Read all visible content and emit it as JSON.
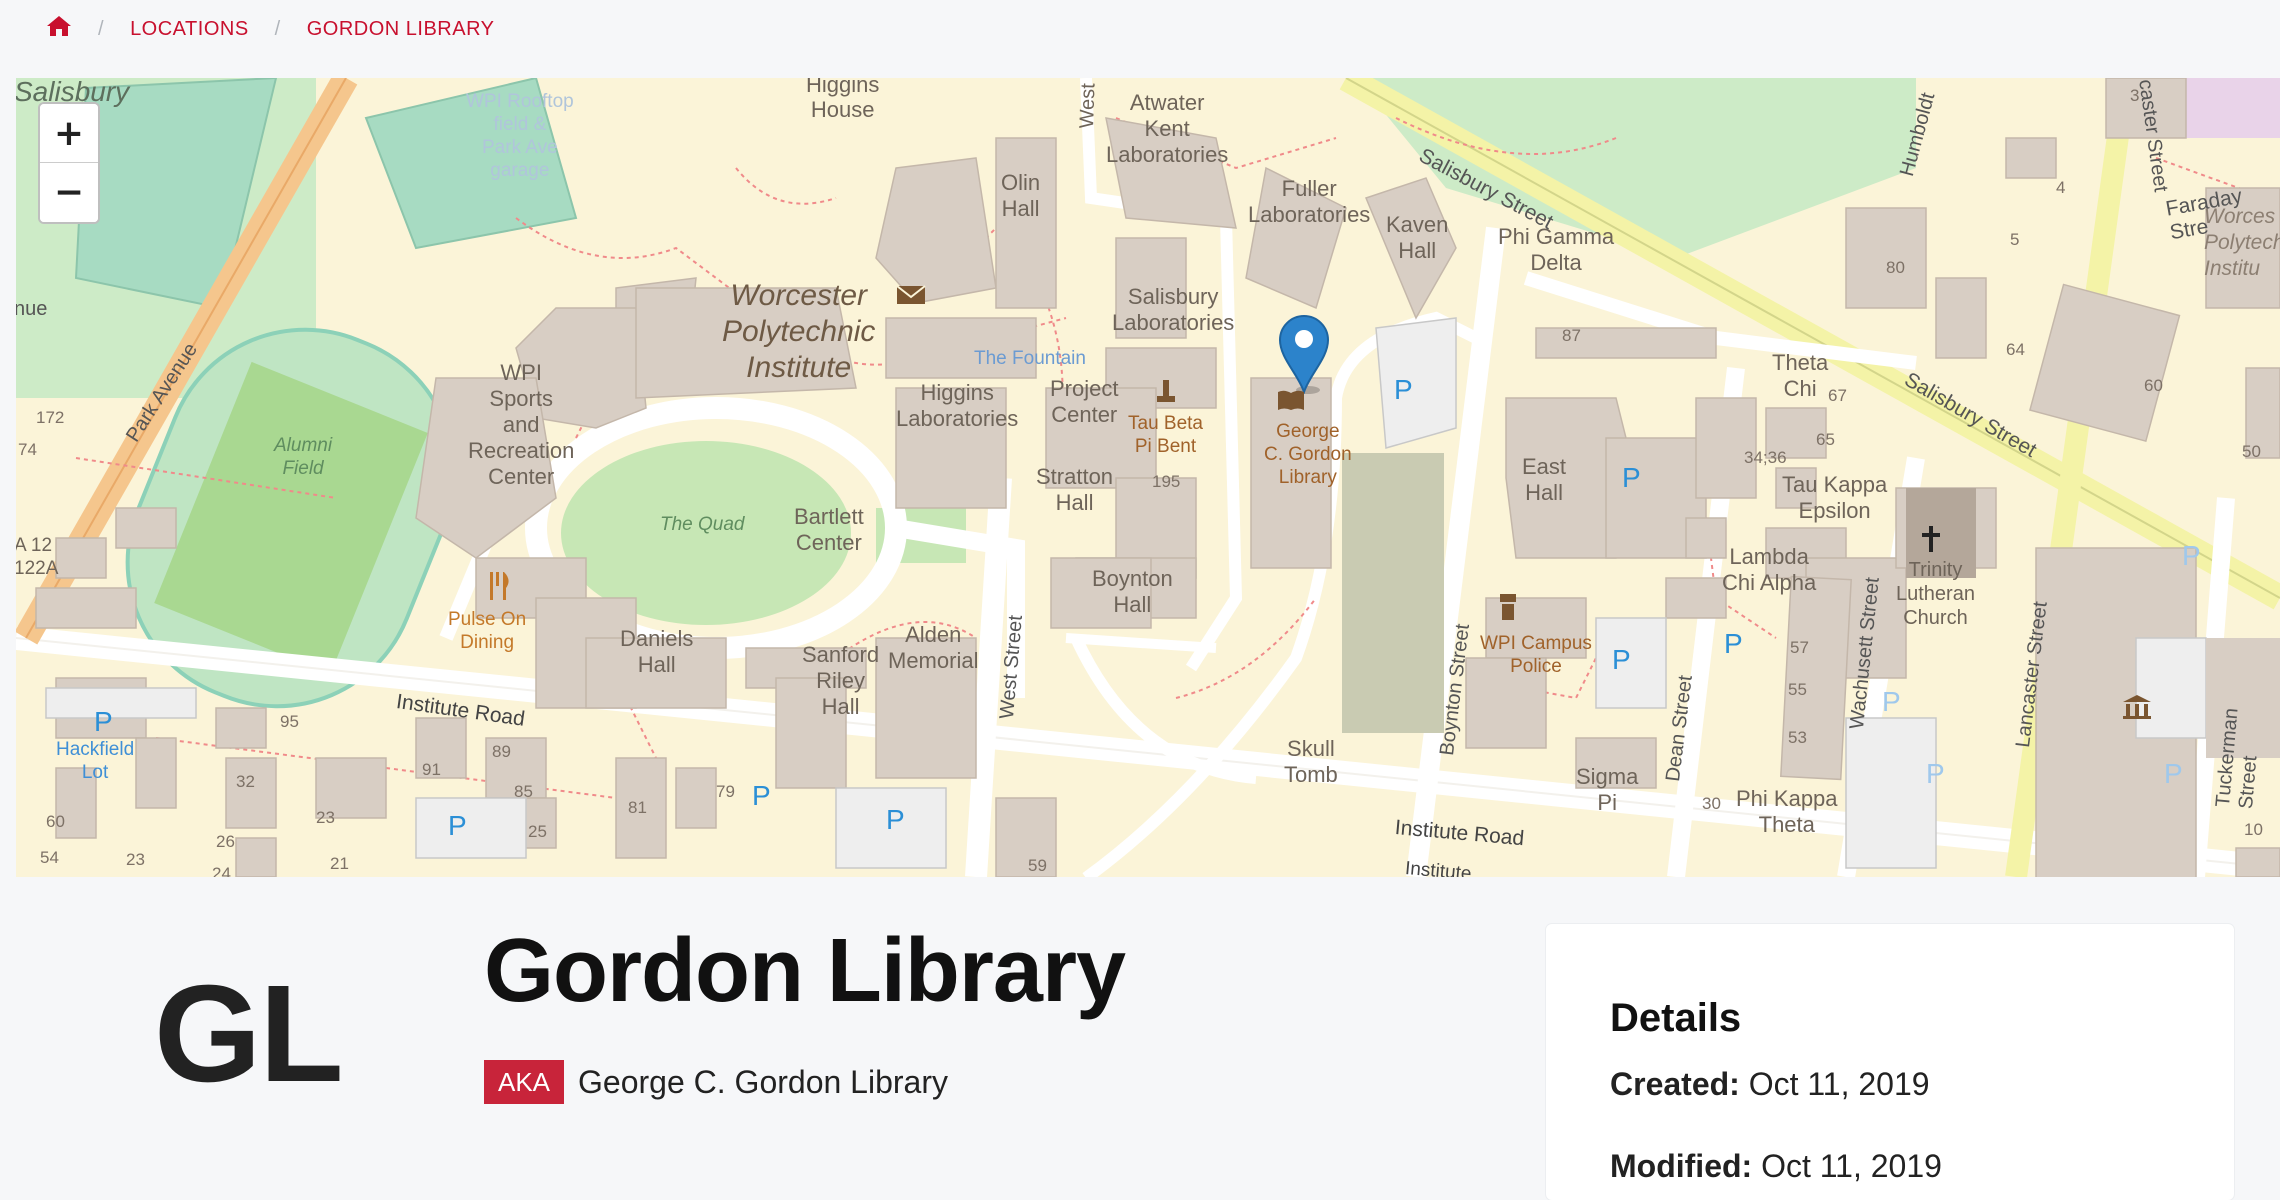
{
  "breadcrumb": {
    "home_icon": "home-icon",
    "items": [
      "LOCATIONS",
      "GORDON LIBRARY"
    ]
  },
  "map": {
    "zoom_in": "+",
    "zoom_out": "−",
    "marker_icon": "map-pin-icon",
    "labels": {
      "salisbury_corner": "Salisbury",
      "rooftop": [
        "WPI Rooftop",
        "field &",
        "Park Ave",
        "garage"
      ],
      "higgins_house": [
        "Higgins",
        "House"
      ],
      "west_top": "West",
      "atwater": [
        "Atwater",
        "Kent",
        "Laboratories"
      ],
      "olin": [
        "Olin",
        "Hall"
      ],
      "fuller": [
        "Fuller",
        "Laboratories"
      ],
      "kaven": [
        "Kaven",
        "Hall"
      ],
      "phi_gamma": [
        "Phi Gamma",
        "Delta"
      ],
      "salisbury_street": "Salisbury Street",
      "salisbury_street_2": "Salisbury Street",
      "humboldt": "Humboldt",
      "lancaster_top": "caster Street",
      "faraday": "Faraday Stre",
      "wpi_corner": [
        "Worces",
        "Polytech",
        "Institu"
      ],
      "worcester_poly": [
        "Worcester",
        "Polytechnic",
        "Institute"
      ],
      "salisbury_labs": [
        "Salisbury",
        "Laboratories"
      ],
      "the_fountain": "The Fountain",
      "park_avenue": "Park Avenue",
      "nue": "nue",
      "wpi_sports": [
        "WPI",
        "Sports",
        "and",
        "Recreation",
        "Center"
      ],
      "alumni_field": [
        "Alumni",
        "Field"
      ],
      "higgins_labs": [
        "Higgins",
        "Laboratories"
      ],
      "project_center": [
        "Project",
        "Center"
      ],
      "tau_beta": [
        "Tau Beta",
        "Pi Bent"
      ],
      "gordon_library": [
        "George",
        "C. Gordon",
        "Library"
      ],
      "theta_chi": [
        "Theta",
        "Chi"
      ],
      "east_hall": [
        "East",
        "Hall"
      ],
      "tau_kappa": [
        "Tau Kappa",
        "Epsilon"
      ],
      "lambda_chi": [
        "Lambda",
        "Chi Alpha"
      ],
      "trinity": [
        "Trinity",
        "Lutheran",
        "Church"
      ],
      "the_quad": "The Quad",
      "bartlett": [
        "Bartlett",
        "Center"
      ],
      "stratton": [
        "Stratton",
        "Hall"
      ],
      "boynton_hall": [
        "Boynton",
        "Hall"
      ],
      "pulse_on": [
        "Pulse On",
        "Dining"
      ],
      "daniels": [
        "Daniels",
        "Hall"
      ],
      "sanford": [
        "Sanford",
        "Riley",
        "Hall"
      ],
      "alden": [
        "Alden",
        "Memorial"
      ],
      "west_street": "West Street",
      "boynton_street": "Boynton Street",
      "police": [
        "WPI Campus",
        "Police"
      ],
      "dean_street": "Dean Street",
      "wachusett": "Wachusett Street",
      "lancaster": "Lancaster Street",
      "tuckerman": "Tuckerman Street",
      "institute_road": "Institute Road",
      "institute_road_2": "Institute Road",
      "institute_bottom": "Institute",
      "hackfield": [
        "Hackfield",
        "Lot"
      ],
      "skull_tomb": [
        "Skull",
        "Tomb"
      ],
      "sigma_pi": [
        "Sigma",
        "Pi"
      ],
      "phi_kappa": [
        "Phi Kappa",
        "Theta"
      ],
      "a12": [
        "A 12",
        "122A"
      ],
      "parking": "P",
      "numbers": {
        "n172": "172",
        "n74": "74",
        "n95": "95",
        "n32": "32",
        "n91": "91",
        "n89": "89",
        "n85": "85",
        "n23": "23",
        "n60": "60",
        "n54": "54",
        "n26": "26",
        "n21": "21",
        "n25": "25",
        "n81": "81",
        "n79": "79",
        "n59": "59",
        "n195": "195",
        "n87": "87",
        "n67": "67",
        "n65": "65",
        "n3436": "34;36",
        "n57": "57",
        "n55": "55",
        "n53": "53",
        "n30": "30",
        "n80": "80",
        "n5": "5",
        "n4": "4",
        "n64": "64",
        "n60b": "60",
        "n50": "50",
        "n3": "3",
        "n10": "10",
        "n24": "24",
        "n23b": "23"
      }
    }
  },
  "building": {
    "initials": "GL",
    "name": "Gordon Library",
    "aka_label": "AKA",
    "aka_value": "George C. Gordon Library"
  },
  "details": {
    "heading": "Details",
    "created_label": "Created:",
    "created_value": "Oct 11, 2019",
    "modified_label": "Modified:",
    "modified_value": "Oct 11, 2019"
  },
  "colors": {
    "accent": "#c8102e",
    "map_bg": "#fbf4d8",
    "building": "#d8cec4",
    "marker": "#2c83cb"
  }
}
